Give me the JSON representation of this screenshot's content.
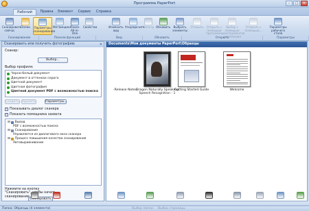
{
  "window": {
    "title": "Программа PaperPort",
    "min_glyph": "–",
    "max_glyph": "□",
    "close_glyph": "✕"
  },
  "tabs": [
    "Рабочий стол",
    "Правка",
    "Элемент",
    "Сервис",
    "Справка"
  ],
  "ribbon": {
    "buttons": [
      {
        "label": "Сканировать сейчас",
        "icon": "scanner-icon",
        "color": "#6d8fbf"
      },
      {
        "label": "Папки",
        "icon": "folders-icon",
        "color": "#e5b54a"
      },
      {
        "label": "Параметры сканирования",
        "icon": "scan-settings-icon",
        "color": "#7aa0cf"
      },
      {
        "label": "Метаиндекс",
        "icon": "metaindex-icon",
        "color": "#8ab0d8"
      },
      {
        "label": "Поиск All-in-One",
        "icon": "search-icon",
        "color": "#6f94c4"
      },
      {
        "label": "Свойства",
        "icon": "properties-icon",
        "color": "#9eb6d4"
      },
      {
        "label": "Изменить вид",
        "icon": "view-icon",
        "color": "#7f9fca"
      },
      {
        "label": "Упорядочить",
        "icon": "sort-icon",
        "color": "#8fb0d8"
      },
      {
        "label": "Фильтр",
        "icon": "filter-icon",
        "color": "#b7c6d9"
      },
      {
        "label": "Обновить",
        "icon": "refresh-icon",
        "color": "#5ca05c"
      },
      {
        "label": "Выбрать элементы",
        "icon": "select-items-icon",
        "color": "#7d9ccb"
      },
      {
        "label": "Открыть",
        "icon": "open-icon",
        "color": "#c9d3e0"
      },
      {
        "label": "Открыть с помощью программы",
        "icon": "open-with-icon",
        "color": "#c9d3e0"
      },
      {
        "label": "Выбор с помощью инструментов извлечения",
        "icon": "extract-icon",
        "color": "#c9d3e0"
      },
      {
        "label": "Открыть с помощью...",
        "icon": "open-with-program-icon",
        "color": "#c9d3e0"
      },
      {
        "label": "Параметры рабочего стола",
        "icon": "desktop-settings-icon",
        "color": "#6f94c4"
      }
    ],
    "groups": [
      "Сканирование",
      "Панели функций",
      "Вид",
      "Обновить",
      "Открыть",
      "Параметры"
    ]
  },
  "left_pane": {
    "title": "Сканировать или получить фотографию",
    "close_glyph": "✕",
    "scanner_label": "Сканер:",
    "select_button": "Выбор...",
    "profile_label": "Выбор профиля:",
    "profiles": [
      {
        "label": "Черно-белый документ",
        "selected": false
      },
      {
        "label": "Документ в оттенках серого",
        "selected": false
      },
      {
        "label": "Цветной документ",
        "selected": false
      },
      {
        "label": "Цветная фотография",
        "selected": false
      },
      {
        "label": "Цветной документ PDF с возможностью поиска",
        "selected": true
      }
    ],
    "buttons": {
      "create": "Создать...",
      "delete": "Удалить",
      "params": "Параметры..."
    },
    "checkboxes": [
      {
        "label": "Показывать диалог сканера",
        "checked": true
      },
      {
        "label": "Показать помощника захвата",
        "checked": true
      }
    ],
    "tree": [
      {
        "label": "Вывод",
        "indent": 0,
        "icon": "output-icon"
      },
      {
        "label": "PDF с возможностью поиска",
        "indent": 1,
        "icon": ""
      },
      {
        "label": "Сканирование",
        "indent": 0,
        "icon": "scan-icon"
      },
      {
        "label": "Управляется из диалогового окна сканера",
        "indent": 1,
        "icon": ""
      },
      {
        "label": "Процесс повышения качества сканирования",
        "indent": 0,
        "icon": "enhance-icon"
      },
      {
        "label": "Автовыравнивание",
        "indent": 1,
        "icon": ""
      }
    ],
    "hint": "Нажмите на кнопку \"Сканировать\", чтобы начать сканирование.",
    "scan_button": "Сканировать"
  },
  "right_pane": {
    "path": "Documents\\Мои документы PaperPort\\Образцы",
    "documents": [
      {
        "label": "-Release Notes-",
        "kind": "text-only"
      },
      {
        "label": "Dragon Naturally Speaking Speech Recognition - 1",
        "kind": "photo"
      },
      {
        "label": "Getting Started Guide",
        "kind": "guide"
      },
      {
        "label": "Welcome",
        "kind": "letter"
      }
    ]
  },
  "app_bar": [
    {
      "icon": "send-to-icon",
      "color": "#6f6f6f"
    },
    {
      "icon": "pdf-icon",
      "color": "#c0301f"
    },
    {
      "icon": "paint-icon",
      "color": "#5a7fb0"
    },
    {
      "icon": "document-icon",
      "color": "#6f94c4"
    },
    {
      "icon": "spreadsheet-icon",
      "color": "#5a9c56"
    },
    {
      "icon": "notepad-icon",
      "color": "#8e9bb0"
    },
    {
      "icon": "fax-icon",
      "color": "#333333"
    },
    {
      "icon": "ocr-icon",
      "color": "#8a97aa"
    },
    {
      "icon": "ftp-icon",
      "color": "#9aa5b5"
    },
    {
      "icon": "mail-icon",
      "color": "#6f94c4"
    },
    {
      "icon": "ebook-icon",
      "color": "#5aa04c"
    }
  ],
  "status": {
    "left": "Папка: Образцы (4 элемента)",
    "mid1": "Выбор папки",
    "mid2": "Выбор страницы"
  }
}
